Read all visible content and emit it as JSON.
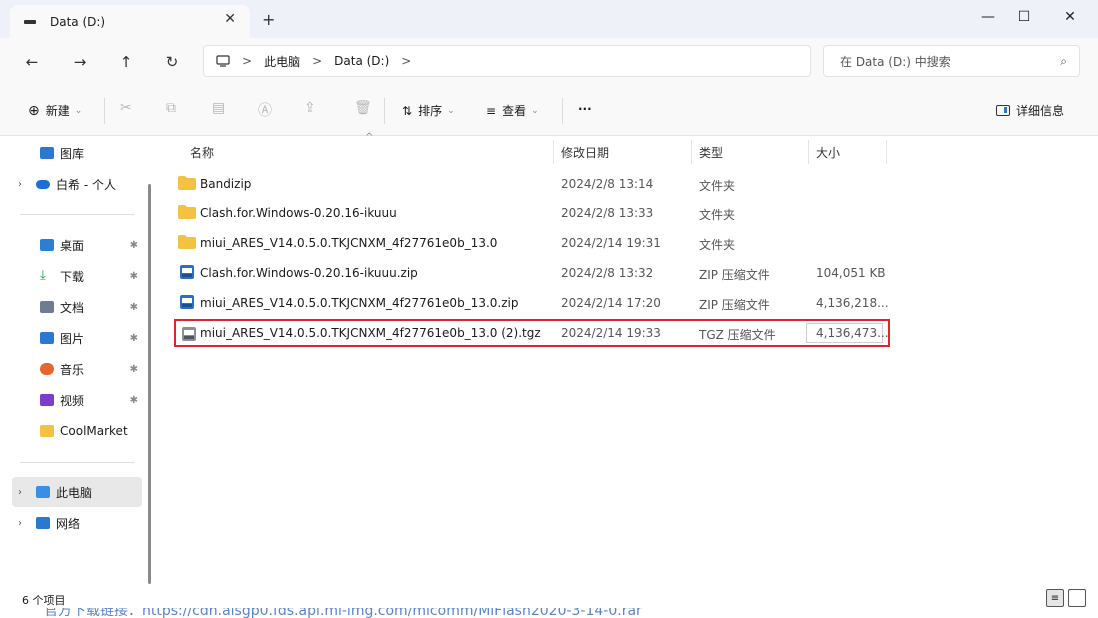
{
  "tab": {
    "title": "Data (D:)",
    "close": "✕",
    "new_tab": "+"
  },
  "window_controls": {
    "minimize": "—",
    "maximize": "☐",
    "close": "✕"
  },
  "nav": {
    "back": "←",
    "forward": "→",
    "up": "↑",
    "refresh": "↻",
    "breadcrumb": [
      "此电脑",
      "Data (D:)"
    ],
    "search_placeholder": "在 Data (D:) 中搜索"
  },
  "toolbar": {
    "new_label": "新建",
    "sort_label": "排序",
    "view_label": "查看",
    "more_label": "···",
    "details_label": "详细信息"
  },
  "sidebar": {
    "gallery": "图库",
    "cloud": "白希 - 个人",
    "quick": [
      {
        "label": "桌面",
        "color": "#2a7fd4"
      },
      {
        "label": "下载",
        "color": "#1a9b4f"
      },
      {
        "label": "文档",
        "color": "#6e7d91"
      },
      {
        "label": "图片",
        "color": "#2b78d0"
      },
      {
        "label": "音乐",
        "color": "#e5672f"
      },
      {
        "label": "视频",
        "color": "#7d3cc9"
      }
    ],
    "coolmarket": "CoolMarket",
    "this_pc": "此电脑",
    "network": "网络"
  },
  "columns": {
    "name": "名称",
    "modified": "修改日期",
    "type": "类型",
    "size": "大小"
  },
  "files": [
    {
      "name": "Bandizip",
      "modified": "2024/2/8 13:14",
      "type": "文件夹",
      "size": "",
      "kind": "folder"
    },
    {
      "name": "Clash.for.Windows-0.20.16-ikuuu",
      "modified": "2024/2/8 13:33",
      "type": "文件夹",
      "size": "",
      "kind": "folder"
    },
    {
      "name": "miui_ARES_V14.0.5.0.TKJCNXM_4f27761e0b_13.0",
      "modified": "2024/2/14 19:31",
      "type": "文件夹",
      "size": "",
      "kind": "folder"
    },
    {
      "name": "Clash.for.Windows-0.20.16-ikuuu.zip",
      "modified": "2024/2/8 13:32",
      "type": "ZIP 压缩文件",
      "size": "104,051 KB",
      "kind": "zip"
    },
    {
      "name": "miui_ARES_V14.0.5.0.TKJCNXM_4f27761e0b_13.0.zip",
      "modified": "2024/2/14 17:20",
      "type": "ZIP 压缩文件",
      "size": "4,136,218...",
      "kind": "zip"
    },
    {
      "name": "miui_ARES_V14.0.5.0.TKJCNXM_4f27761e0b_13.0 (2).tgz",
      "modified": "2024/2/14 19:33",
      "type": "TGZ 压缩文件",
      "size": "4,136,473...",
      "kind": "tgz"
    }
  ],
  "status": {
    "count": "6 个项目"
  },
  "behind_text": "官方下载链接：https://cdn.alsgp0.fds.api.mi-img.com/micomm/MiFlash2020-3-14-0.rar"
}
